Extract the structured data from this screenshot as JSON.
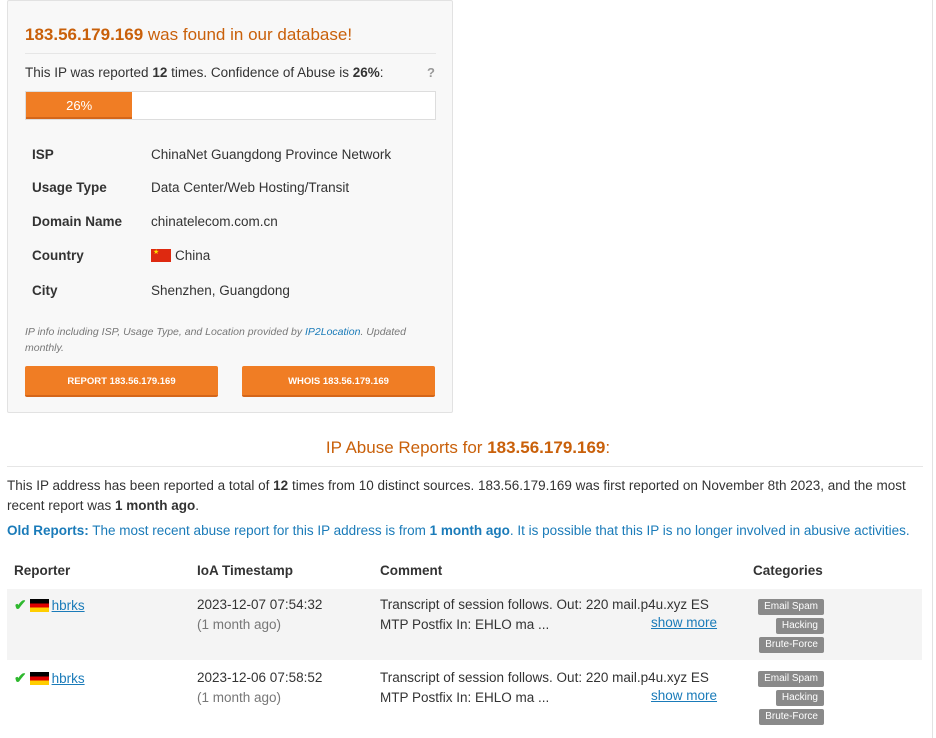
{
  "card": {
    "ip": "183.56.179.169",
    "title_suffix": " was found in our database!",
    "reported_prefix": "This IP was reported ",
    "reported_count": "12",
    "reported_mid": " times. Confidence of Abuse is ",
    "confidence": "26%",
    "reported_suffix": ":",
    "help": "?",
    "progress_label": "26%",
    "progress_value": 0.26,
    "info": [
      {
        "label": "ISP",
        "value": "ChinaNet Guangdong Province Network"
      },
      {
        "label": "Usage Type",
        "value": "Data Center/Web Hosting/Transit"
      },
      {
        "label": "Domain Name",
        "value": "chinatelecom.com.cn"
      },
      {
        "label": "Country",
        "value": "China"
      },
      {
        "label": "City",
        "value": "Shenzhen, Guangdong"
      }
    ],
    "note_prefix": "IP info including ISP, Usage Type, and Location provided by ",
    "note_link": "IP2Location",
    "note_suffix": ". Updated monthly.",
    "report_button": "REPORT 183.56.179.169",
    "whois_button": "WHOIS 183.56.179.169"
  },
  "reports": {
    "title_prefix": "IP Abuse Reports for ",
    "title_ip": "183.56.179.169",
    "title_suffix": ":",
    "summary_1": "This IP address has been reported a total of ",
    "summary_count": "12",
    "summary_2": " times from 10 distinct sources. 183.56.179.169 was first reported on November 8th 2023, and the most recent report was ",
    "summary_recent": "1 month ago",
    "summary_3": ".",
    "old_label": "Old Reports:",
    "old_1": " The most recent abuse report for this IP address is from ",
    "old_recent": "1 month ago",
    "old_2": ". It is possible that this IP is no longer involved in abusive activities.",
    "headers": {
      "reporter": "Reporter",
      "timestamp": "IoA Timestamp",
      "comment": "Comment",
      "categories": "Categories"
    },
    "rows": [
      {
        "check": "✔",
        "reporter": "hbrks",
        "timestamp": "2023-12-07 07:54:32",
        "ago": "(1 month ago)",
        "comment_1": "Transcript of session follows. Out: 220 mail.p4u.xyz ES",
        "comment_2": "MTP Postfix In: EHLO ma ...",
        "show_more": "show more",
        "categories": [
          "Email Spam",
          "Hacking",
          "Brute-Force"
        ]
      },
      {
        "check": "✔",
        "reporter": "hbrks",
        "timestamp": "2023-12-06 07:58:52",
        "ago": "(1 month ago)",
        "comment_1": "Transcript of session follows. Out: 220 mail.p4u.xyz ES",
        "comment_2": "MTP Postfix In: EHLO ma ...",
        "show_more": "show more",
        "categories": [
          "Email Spam",
          "Hacking",
          "Brute-Force"
        ]
      }
    ]
  }
}
